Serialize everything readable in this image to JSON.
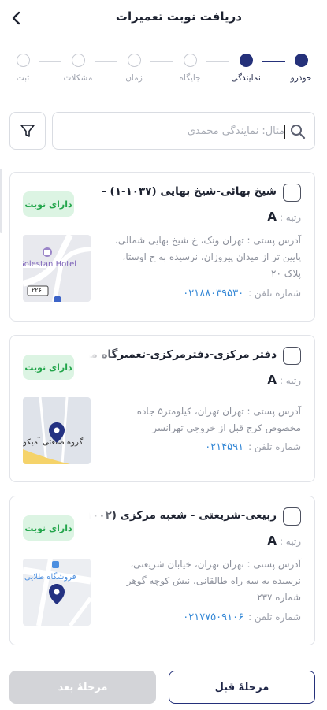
{
  "header": {
    "title": "دریافت نوبت تعمیرات"
  },
  "stepper": {
    "steps": [
      {
        "label": "خودرو"
      },
      {
        "label": "نمایندگی"
      },
      {
        "label": "جایگاه"
      },
      {
        "label": "زمان"
      },
      {
        "label": "مشکلات"
      },
      {
        "label": "ثبت"
      }
    ],
    "completed_steps": 2
  },
  "search": {
    "placeholder": "مثال: نمایندگی محمدی"
  },
  "cards": [
    {
      "title": "شیخ بهائی-شیخ بهایی (۱۰۳۷-۱) -",
      "rank_label": "رتبه :",
      "rank": "A",
      "badge": "دارای نوبت",
      "address": "آدرس پستی : تهران ونک، خ شیخ بهایی شمالی، پایین تر از میدان پیروزان، نرسیده به خ اوستا، پلاک ۲۰",
      "phone_label": "شماره تلفن :",
      "phone": "۰۲۱۸۸۰۳۹۵۳۰",
      "map_labels": [
        "Golestan Hotel",
        "۲۲۶"
      ]
    },
    {
      "title": "دفتر مرکزی-دفترمرکزی-تعمیرگاه مرکزی (۹",
      "rank_label": "رتبه :",
      "rank": "A",
      "badge": "دارای نوبت",
      "address": "آدرس پستی : تهران تهران، کیلومتر۵ جاده مخصوص کرج قبل از خروجی تهرانسر",
      "phone_label": "شماره تلفن :",
      "phone": "۰۲۱۴۵۹۱",
      "map_labels": [
        "گروه صنعتی آمیکو"
      ]
    },
    {
      "title": "ربیعی-شریعتی - شعبه مرکزی (۱۰۰۲-۱) -",
      "rank_label": "رتبه :",
      "rank": "A",
      "badge": "دارای نوبت",
      "address": "آدرس پستی : تهران تهران، خیابان شریعتی، نرسیده به سه راه طالقانی، نبش کوچه گوهر شماره ۲۳۷",
      "phone_label": "شماره تلفن :",
      "phone": "۰۲۱۷۷۵۰۹۱۰۶",
      "map_labels": [
        "فروشگاه طلایی"
      ]
    }
  ],
  "footer": {
    "next_label": "مرحلهٔ بعد",
    "prev_label": "مرحلهٔ قبل"
  },
  "colors": {
    "primary": "#25317a",
    "badge_bg": "#dcf4e3",
    "badge_text": "#23a54b",
    "phone": "#3588d6",
    "disabled": "#d3d4d8"
  }
}
